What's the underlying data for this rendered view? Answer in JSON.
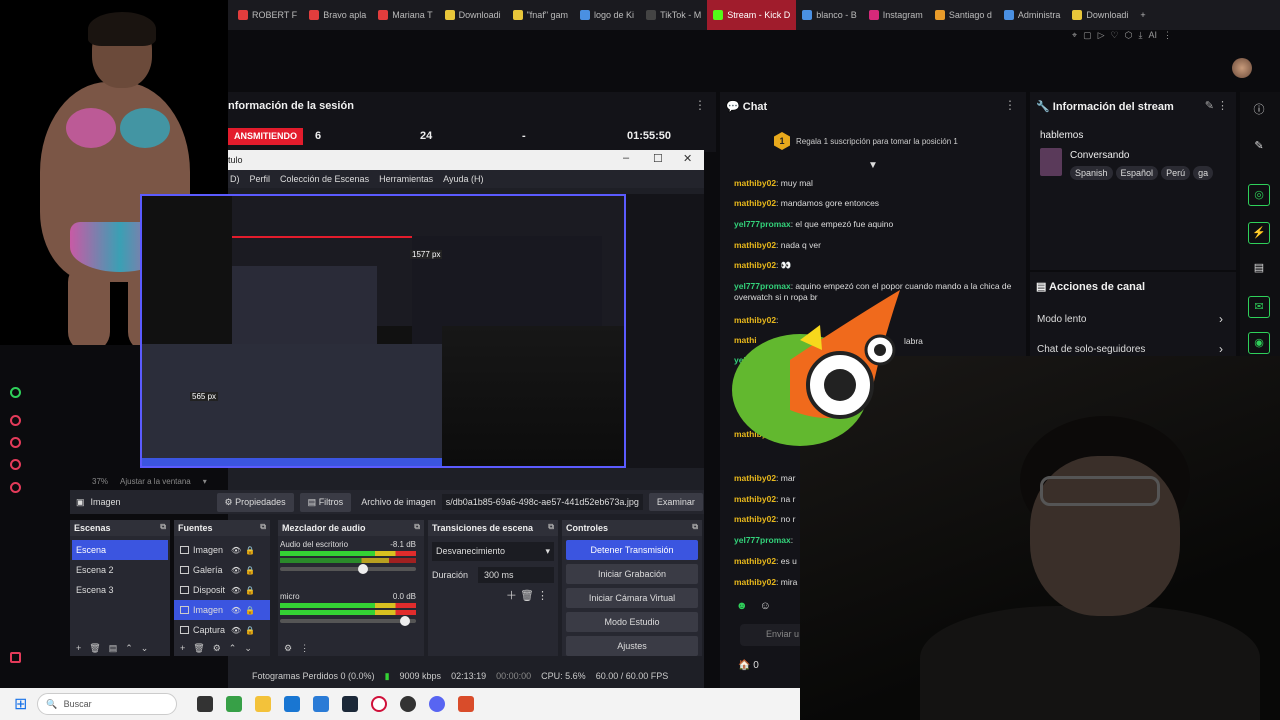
{
  "browser": {
    "tabs": [
      {
        "label": "ROBERT F",
        "color": "#e23d3d"
      },
      {
        "label": "Bravo apla",
        "color": "#e23d3d"
      },
      {
        "label": "Mariana T",
        "color": "#e23d3d"
      },
      {
        "label": "Downloadi",
        "color": "#e8c63a"
      },
      {
        "label": "\"fnaf\" gam",
        "color": "#e8c63a"
      },
      {
        "label": "logo de Ki",
        "color": "#4a90e2"
      },
      {
        "label": "TikTok - M",
        "color": "#444"
      },
      {
        "label": "Stream - Kick D",
        "color": "#53fc18"
      },
      {
        "label": "blanco - B",
        "color": "#4a90e2"
      },
      {
        "label": "Instagram",
        "color": "#d6297a"
      },
      {
        "label": "Santiago d",
        "color": "#e89b2a"
      },
      {
        "label": "Administra",
        "color": "#4a90e2"
      },
      {
        "label": "Downloadi",
        "color": "#e8c63a"
      }
    ],
    "new_tab": "+",
    "toolbar_ai": "AI"
  },
  "session": {
    "title": "nformación de la sesión",
    "live_label": "ANSMITIENDO",
    "stat1": "6",
    "stat2": "24",
    "stat3": "-",
    "uptime": "01:55:50",
    "kebab": "⋮"
  },
  "obs": {
    "window_title": "tulo",
    "menu": [
      "D)",
      "Perfil",
      "Colección de Escenas",
      "Herramientas",
      "Ayuda (H)"
    ],
    "preview_overlay_w": "1577 px",
    "preview_overlay_h": "565 px",
    "zoom": "37%",
    "fit": "Ajustar a la ventana",
    "source_type": "Imagen",
    "props_btn": "Propiedades",
    "filters_btn": "Filtros",
    "file_label": "Archivo de imagen",
    "file_path": "s/db0a1b85-69a6-498c-ae57-441d52eb673a.jpg",
    "browse_btn": "Examinar",
    "docks": {
      "scenes_title": "Escenas",
      "scenes": [
        "Escena",
        "Escena 2",
        "Escena 3"
      ],
      "sources_title": "Fuentes",
      "sources": [
        "Imagen",
        "Galería",
        "Disposit",
        "Imagen",
        "Captura"
      ],
      "mixer_title": "Mezclador de audio",
      "ch1_name": "Audio del escritorio",
      "ch1_db": "-8.1 dB",
      "ch2_name": "micro",
      "ch2_db": "0.0 dB",
      "ch1_volume": 0.62,
      "ch2_volume": 0.95,
      "transitions_title": "Transiciones de escena",
      "transition": "Desvanecimiento",
      "duration_label": "Duración",
      "duration": "300 ms",
      "controls_title": "Controles",
      "controls": [
        "Detener Transmisión",
        "Iniciar Grabación",
        "Iniciar Cámara Virtual",
        "Modo Estudio",
        "Ajustes"
      ]
    },
    "status": {
      "dropped": "Fotogramas Perdidos 0 (0.0%)",
      "bitrate": "9009 kbps",
      "stream_time": "02:13:19",
      "rec_time": "00:00:00",
      "cpu": "CPU: 5.6%",
      "fps": "60.00 / 60.00 FPS"
    }
  },
  "chat": {
    "title": "Chat",
    "gift_rank": "1",
    "gift_text": "Regala 1 suscripción para tomar la posición 1",
    "messages": [
      {
        "user": "mathiby02",
        "text": ": muy mal",
        "cls": "u-a"
      },
      {
        "user": "mathiby02",
        "text": ": mandamos gore entonces",
        "cls": "u-a"
      },
      {
        "user": "yel777promax",
        "text": ": el que empezó fue aquino",
        "cls": "u-b"
      },
      {
        "user": "mathiby02",
        "text": ": nada q ver",
        "cls": "u-a"
      },
      {
        "user": "mathiby02",
        "text": ": 👀",
        "cls": "u-a"
      },
      {
        "user": "yel777promax",
        "text": ": aquino empezó con el popor cuando mando a la chica de overwatch si n ropa br",
        "cls": "u-b"
      },
      {
        "user": "mathiby02",
        "text": ":",
        "cls": "u-a"
      },
      {
        "user": "mathi",
        "text": "",
        "cls": "u-a"
      },
      {
        "user": "yel",
        "text": "",
        "cls": "u-b"
      },
      {
        "user": "mathiby02",
        "text": ":",
        "cls": "u-a"
      },
      {
        "user": "mathiby02",
        "text": ": mar",
        "cls": "u-a"
      },
      {
        "user": "mathiby02",
        "text": ": na r",
        "cls": "u-a"
      },
      {
        "user": "mathiby02",
        "text": ": no r",
        "cls": "u-a"
      },
      {
        "user": "yel777promax",
        "text": ":",
        "cls": "u-b"
      },
      {
        "user": "mathiby02",
        "text": ": es u",
        "cls": "u-a"
      },
      {
        "user": "mathiby02",
        "text": ": mira",
        "cls": "u-a"
      }
    ],
    "fragment_labra": "labra",
    "input_placeholder": "Enviar u",
    "points": "0"
  },
  "stream_info": {
    "title": "Información del stream",
    "stream_title": "hablemos",
    "category": "Conversando",
    "tags": [
      "Spanish",
      "Español",
      "Perú",
      "ga"
    ]
  },
  "channel_actions": {
    "title": "Acciones de canal",
    "items": [
      "Modo lento",
      "Chat de solo-seguidores"
    ]
  },
  "taskbar": {
    "search_placeholder": "Buscar"
  },
  "colors": {
    "kick_green": "#53fc18",
    "live_red": "#e31c2c",
    "obs_accent": "#3b55e0",
    "gift_gold": "#e8a91c"
  }
}
